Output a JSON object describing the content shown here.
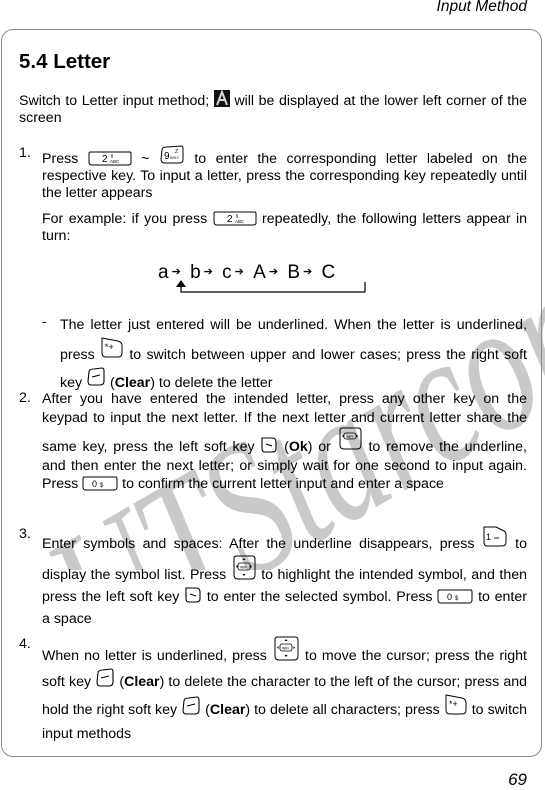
{
  "header": {
    "section_title": "Input Method"
  },
  "page_number": "69",
  "watermark": "UTStarcom",
  "heading": "5.4 Letter",
  "intro": {
    "before_icon": "Switch to Letter input method;",
    "icon": "letter-mode-A-icon",
    "after_icon": "will be displayed at the lower left corner of the screen"
  },
  "items": [
    {
      "number": "1.",
      "p1_a": "Press",
      "key1": "2 ABC",
      "sep": "~",
      "key2": "9 WXYZ",
      "p1_b": "to enter the corresponding letter labeled on the respective key. To input a letter, press the corresponding key repeatedly until the letter appears",
      "p2_a": "For example: if you press",
      "p2_key": "2 ABC",
      "p2_b": "repeatedly, the following letters appear in turn:",
      "sequence": [
        "a",
        "b",
        "c",
        "A",
        "B",
        "C"
      ],
      "sub_dash": "-",
      "sub_a": "The letter just entered will be underlined. When the letter is underlined, press",
      "sub_key1": "* +",
      "sub_b": "to switch between upper and lower cases; press the right soft key",
      "sub_paren_open": "(",
      "sub_bold": "Clear",
      "sub_c": ") to delete the letter"
    },
    {
      "number": "2.",
      "a": "After you have entered the intended letter, press any other key on the keypad to input the next letter. If the next letter and current letter share the same key, press the left soft key",
      "bold1": "Ok",
      "b": "or",
      "c": "to remove the underline, and then enter the next letter; or simply wait for one second to input again. Press",
      "key_zero": "0",
      "d": "to confirm the current letter input and enter a space"
    },
    {
      "number": "3.",
      "a": "Enter symbols and spaces: After the underline disappears, press",
      "key_one": "1",
      "b": "to display the symbol list. Press",
      "c": "to highlight the intended symbol, and then press the left soft key",
      "d": "to enter the selected symbol. Press",
      "key_zero": "0",
      "e": "to enter a space"
    },
    {
      "number": "4.",
      "a": "When no letter is underlined, press",
      "b": "to move the cursor; press the right soft key",
      "bold1": "Clear",
      "c": ") to delete the character to the left of the cursor; press and hold the right soft key",
      "bold2": "Clear",
      "d": ") to delete all characters; press",
      "key_star": "* +",
      "e": "to switch input methods"
    }
  ]
}
